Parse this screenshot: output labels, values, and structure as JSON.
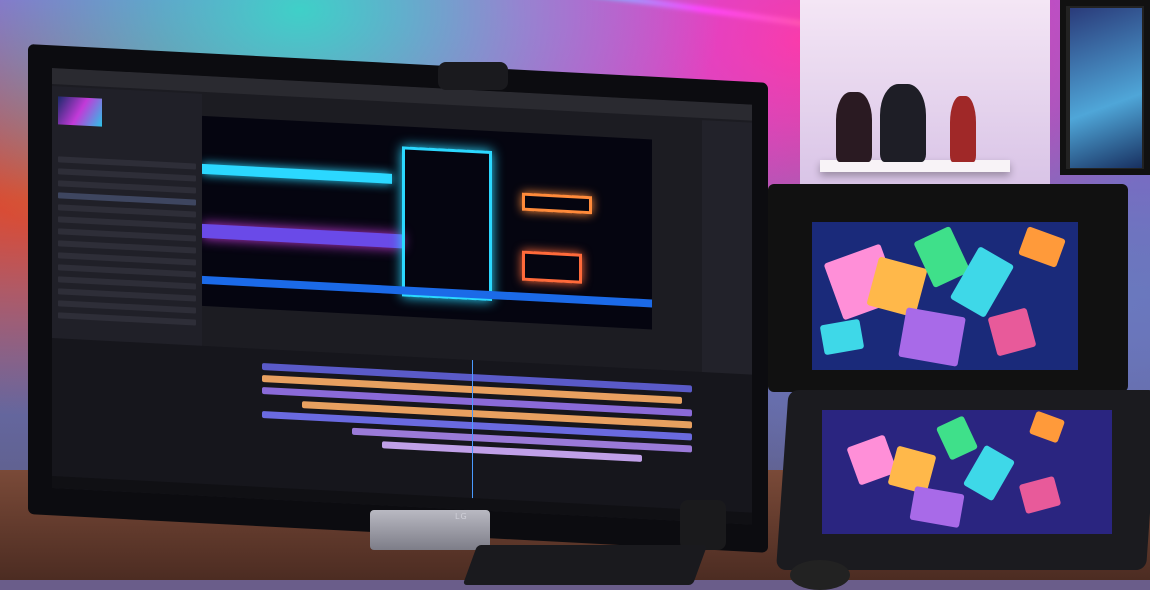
{
  "scene": {
    "monitor_brand": "LG",
    "editor_menu_text": "",
    "project_title": ""
  },
  "colors": {
    "accent_cyan": "#2bd8ff",
    "accent_magenta": "#e04ad8",
    "accent_orange": "#ff8a3a",
    "timeline_purple": "#8a6ad8",
    "timeline_orange": "#e8a060"
  }
}
